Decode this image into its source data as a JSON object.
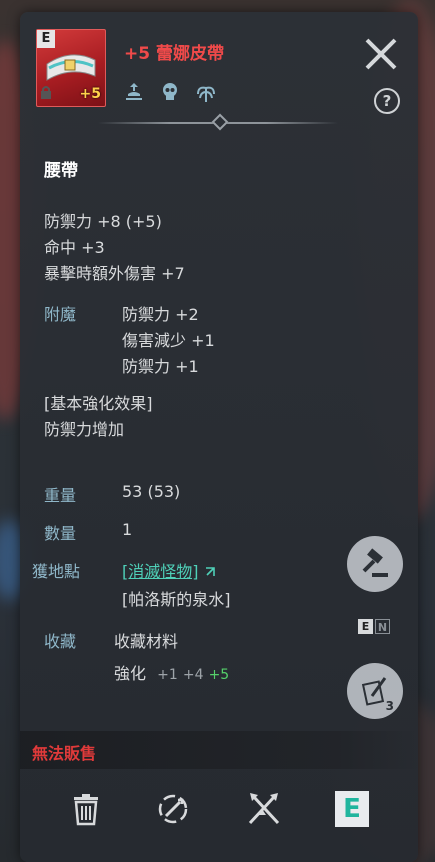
{
  "item": {
    "grade": "E",
    "enhance_badge": "+5",
    "title": "+5 蕾娜皮帶",
    "type": "腰帶"
  },
  "icons": {
    "attr": [
      "trade-icon",
      "skull-icon",
      "plant-icon"
    ],
    "close": "close-icon",
    "help": "?"
  },
  "base_stats": [
    "防禦力 +8 (+5)",
    "命中 +3",
    "暴擊時額外傷害 +7"
  ],
  "enchant": {
    "label": "附魔",
    "lines": [
      "防禦力 +2",
      "傷害減少 +1",
      "防禦力 +1"
    ]
  },
  "enhance_effect": {
    "title": "[基本強化效果]",
    "value": "防禦力增加"
  },
  "info": {
    "weight_label": "重量",
    "weight_value": "53 (53)",
    "count_label": "數量",
    "count_value": "1",
    "location_label": "獲地點",
    "location_link": "[消滅怪物]",
    "location_place": "[帕洛斯的泉水]",
    "collection_label": "收藏",
    "collection_value": "收藏材料",
    "enhance_label": "強化",
    "enhance_a": "+1",
    "enhance_b": "+4",
    "enhance_c": "+5"
  },
  "toggle": {
    "e": "E",
    "n": "N"
  },
  "side_buttons": {
    "memo_count": "3"
  },
  "footer": {
    "unsellable": "無法販售",
    "equip_letter": "E"
  },
  "colors": {
    "title_red": "#f04a4a",
    "link_teal": "#4fd0b8",
    "enhance_green": "#55d06a",
    "unsellable_red": "#e03a3a"
  }
}
